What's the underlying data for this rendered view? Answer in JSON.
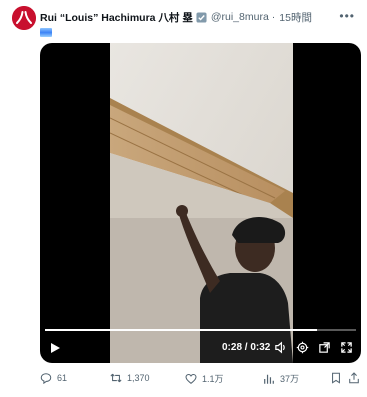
{
  "tweet": {
    "display_name": "Rui “Louis” Hachimura 八村 塁",
    "handle": "@rui_8mura",
    "separator": "·",
    "time": "15時間",
    "avatar_label": "八",
    "icons": {
      "verified": "verified-badge-icon",
      "more": "more-icon",
      "flag": "flag-emoji-icon"
    }
  },
  "video": {
    "timecode": "0:28 / 0:32",
    "progress": 0.875,
    "icons": [
      "play-icon",
      "volume-icon",
      "settings-icon",
      "popout-icon",
      "fullscreen-icon"
    ]
  },
  "actions": {
    "replies": "61",
    "reposts": "1,370",
    "likes": "1.1万",
    "views": "37万"
  },
  "colors": {
    "muted": "#536471",
    "accent": "#1d9bf0",
    "avatar_bg": "#c8102e",
    "verified": "#829aab"
  }
}
